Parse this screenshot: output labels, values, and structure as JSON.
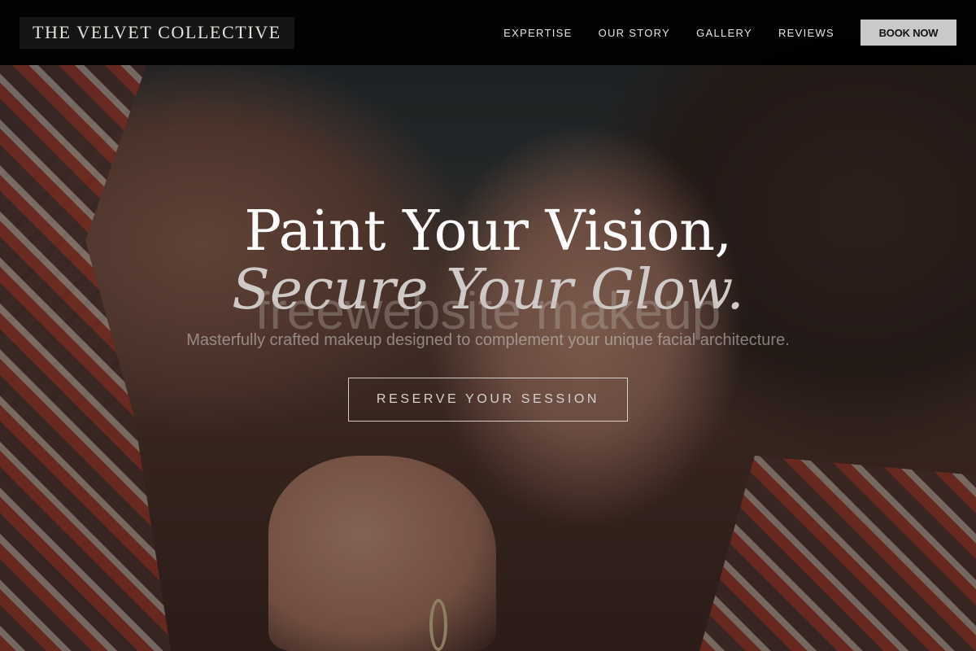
{
  "header": {
    "brand": "THE VELVET COLLECTIVE",
    "nav": [
      {
        "label": "EXPERTISE"
      },
      {
        "label": "OUR STORY"
      },
      {
        "label": "GALLERY"
      },
      {
        "label": "REVIEWS"
      }
    ],
    "book_now_label": "BOOK NOW"
  },
  "hero": {
    "headline_line1": "Paint Your Vision,",
    "headline_line2": "Secure Your Glow.",
    "subtext": "Masterfully crafted makeup designed to complement your unique facial architecture.",
    "watermark": "freewebsite makeup",
    "cta_label": "RESERVE YOUR SESSION"
  },
  "colors": {
    "header_bg": "#000000",
    "book_button_bg": "#c9c9c9",
    "headline": "#ffffff",
    "headline_italic": "#cfcac8"
  }
}
